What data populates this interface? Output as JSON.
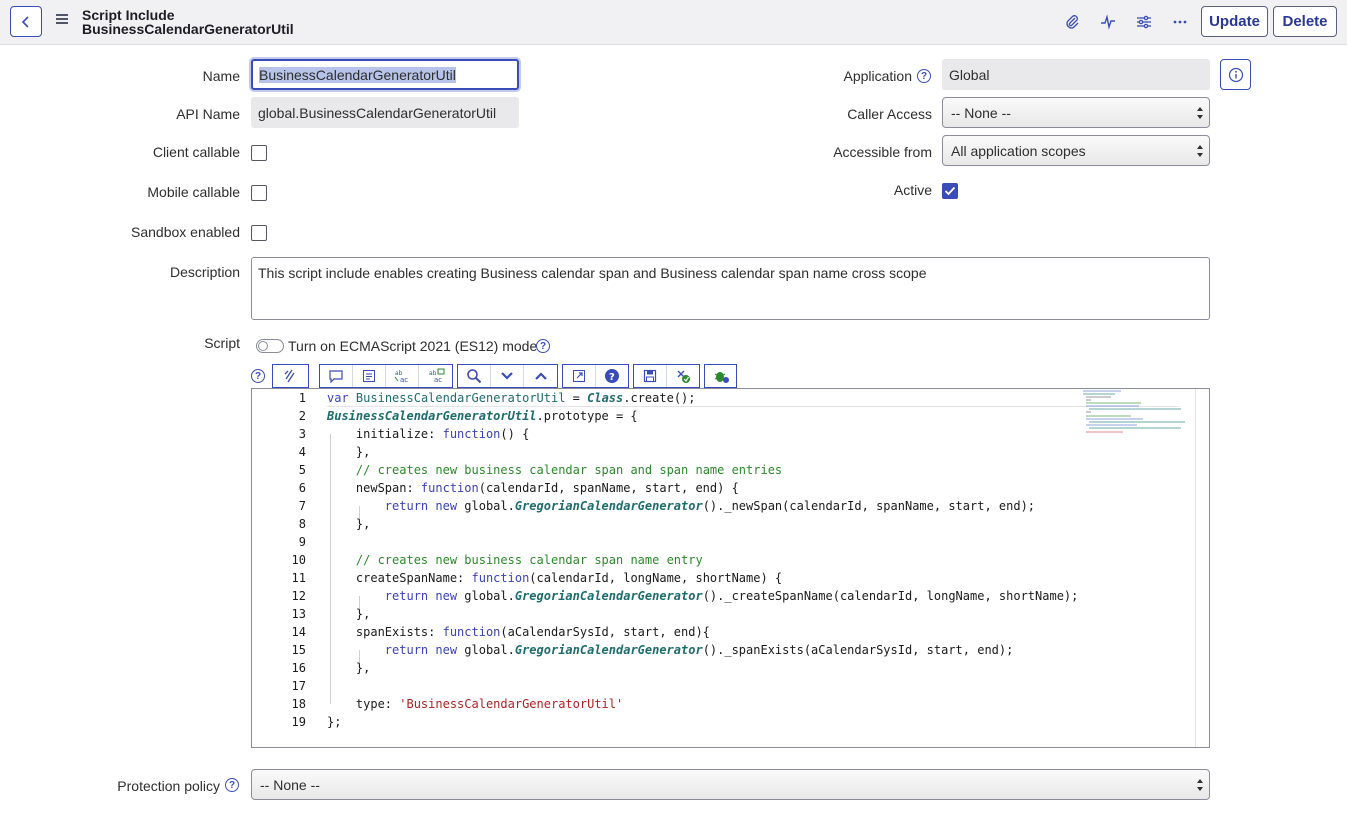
{
  "header": {
    "title_line1": "Script Include",
    "title_line2": "BusinessCalendarGeneratorUtil",
    "update_label": "Update",
    "delete_label": "Delete"
  },
  "form": {
    "name_label": "Name",
    "name_value": "BusinessCalendarGeneratorUtil",
    "api_name_label": "API Name",
    "api_name_value": "global.BusinessCalendarGeneratorUtil",
    "client_callable_label": "Client callable",
    "mobile_callable_label": "Mobile callable",
    "sandbox_enabled_label": "Sandbox enabled",
    "application_label": "Application",
    "application_value": "Global",
    "caller_access_label": "Caller Access",
    "caller_access_value": "-- None --",
    "accessible_from_label": "Accessible from",
    "accessible_from_value": "All application scopes",
    "active_label": "Active",
    "description_label": "Description",
    "description_value": "This script include enables creating Business calendar span and Business calendar span name cross scope",
    "script_label": "Script",
    "es12_toggle_label": "Turn on ECMAScript 2021 (ES12) mode",
    "protection_policy_label": "Protection policy",
    "protection_policy_value": "-- None --"
  },
  "editor": {
    "line_numbers": [
      "1",
      "2",
      "3",
      "4",
      "5",
      "6",
      "7",
      "8",
      "9",
      "10",
      "11",
      "12",
      "13",
      "14",
      "15",
      "16",
      "17",
      "18",
      "19"
    ]
  },
  "colors": {
    "accent": "#3a4cb8",
    "header_bg": "#f1f1f4"
  }
}
